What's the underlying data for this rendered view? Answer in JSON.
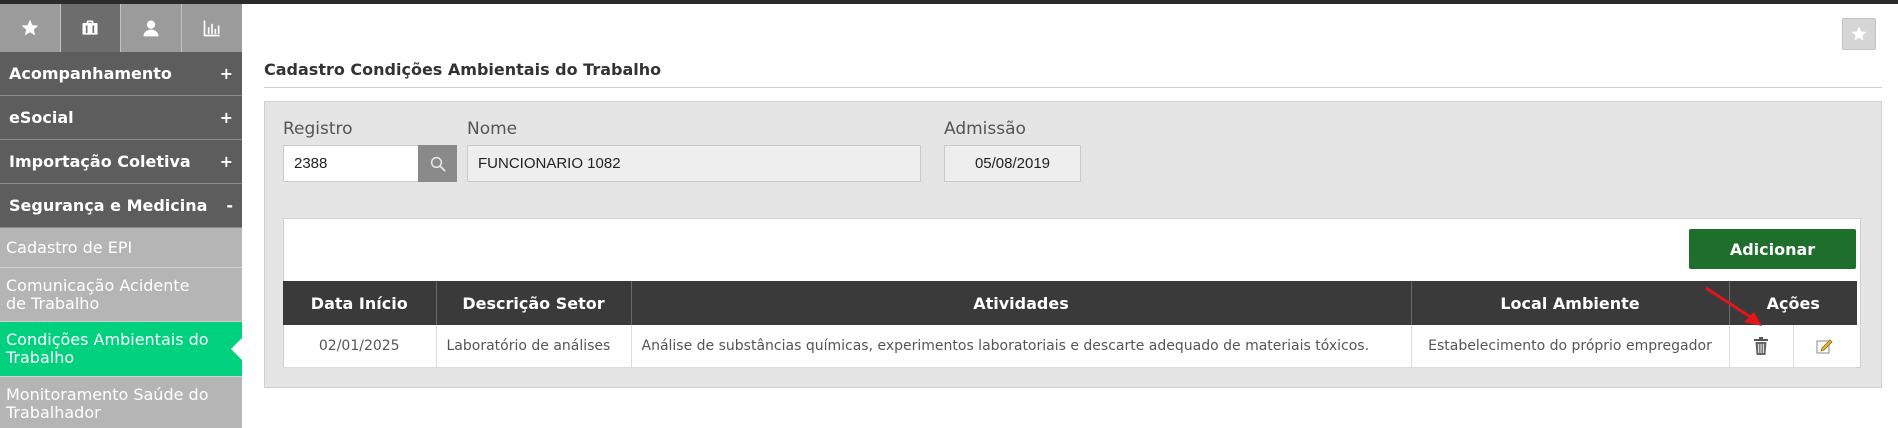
{
  "sidebar": {
    "tabs": [
      {
        "icon": "star-icon",
        "active": false
      },
      {
        "icon": "briefcase-icon",
        "active": true
      },
      {
        "icon": "user-icon",
        "active": false
      },
      {
        "icon": "bar-chart-icon",
        "active": false
      }
    ],
    "menus": [
      {
        "label": "Acompanhamento",
        "sign": "+"
      },
      {
        "label": "eSocial",
        "sign": "+"
      },
      {
        "label": "Importação Coletiva",
        "sign": "+"
      },
      {
        "label": "Segurança e Medicina",
        "sign": "-"
      }
    ],
    "submenu": [
      {
        "label": "Cadastro de EPI"
      },
      {
        "label": "Comunicação Acidente de Trabalho"
      },
      {
        "label": "Condições Ambientais do Trabalho",
        "active": true
      },
      {
        "label": "Monitoramento Saúde do Trabalhador"
      }
    ]
  },
  "page": {
    "title": "Cadastro Condições Ambientais do Trabalho"
  },
  "filter": {
    "registro_label": "Registro",
    "registro_value": "2388",
    "nome_label": "Nome",
    "nome_value": "FUNCIONARIO 1082",
    "admissao_label": "Admissão",
    "admissao_value": "05/08/2019"
  },
  "actions": {
    "add_label": "Adicionar"
  },
  "table": {
    "headers": [
      "Data Início",
      "Descrição Setor",
      "Atividades",
      "Local Ambiente",
      "Ações"
    ],
    "rows": [
      {
        "data_inicio": "02/01/2025",
        "descricao_setor": "Laboratório de análises",
        "atividades": "Análise de substâncias químicas, experimentos laboratoriais e descarte adequado de materiais tóxicos.",
        "local_ambiente": "Estabelecimento do próprio empregador"
      }
    ]
  },
  "colors": {
    "sidebar_header": "#5d5d5d",
    "sidebar_active": "#00d17f",
    "add_button": "#1e6e2c",
    "table_header": "#3a3a3a",
    "annotation_arrow": "#e0161b"
  }
}
